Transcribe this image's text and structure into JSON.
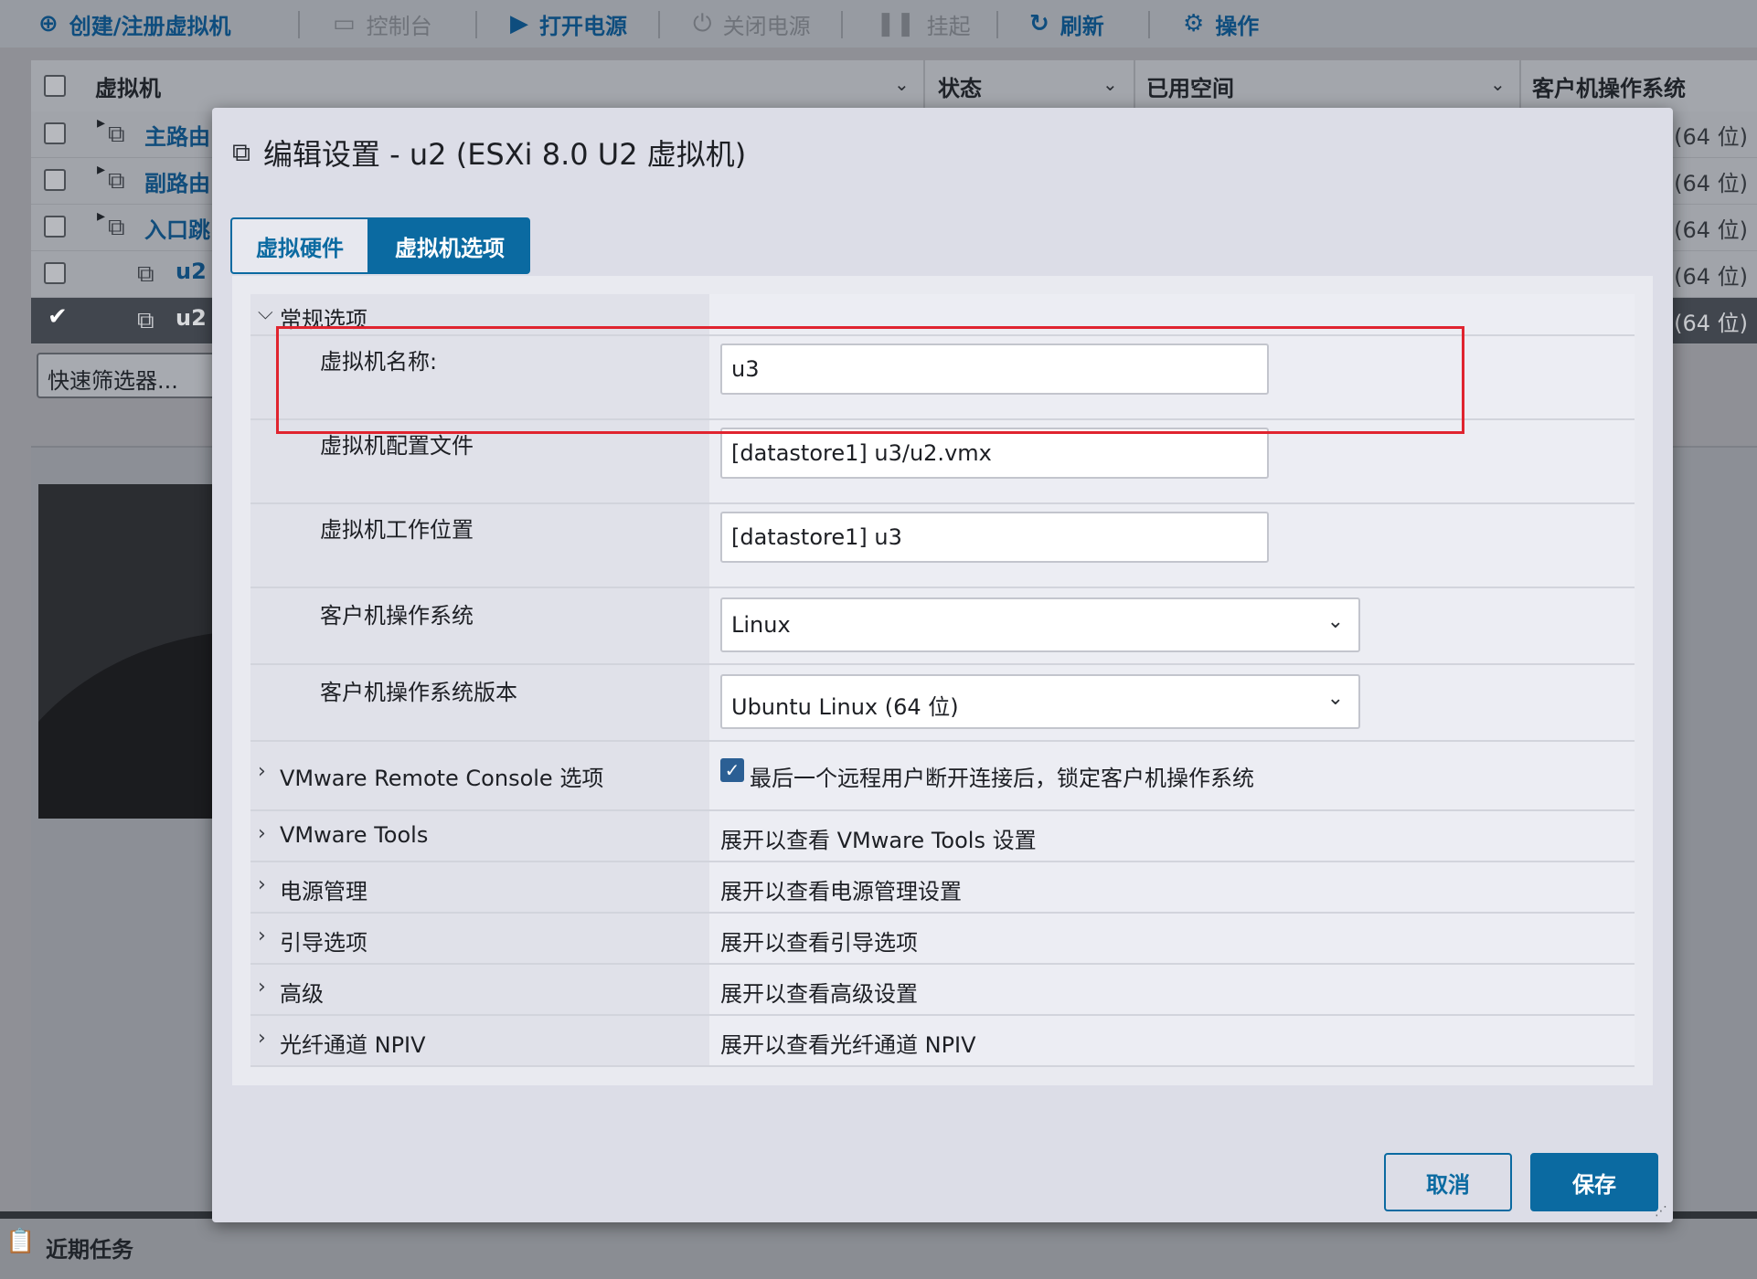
{
  "toolbar": {
    "create": "创建/注册虚拟机",
    "console": "控制台",
    "power_on": "打开电源",
    "power_off": "关闭电源",
    "suspend": "挂起",
    "refresh": "刷新",
    "actions": "操作"
  },
  "grid": {
    "headers": [
      "虚拟机",
      "状态",
      "已用空间",
      "客户机操作系统"
    ],
    "rows": [
      {
        "name": "主路由",
        "os": "(64 位)",
        "selected": false
      },
      {
        "name": "副路由",
        "os": "(64 位)",
        "selected": false
      },
      {
        "name": "入口跳",
        "os": "(64 位)",
        "selected": false
      },
      {
        "name": "u2",
        "os": "(64 位)",
        "selected": false
      },
      {
        "name": "u2",
        "os": "(64 位)",
        "selected": true
      }
    ],
    "filter_placeholder": "快速筛选器..."
  },
  "bottom": {
    "recent_tasks": "近期任务"
  },
  "dialog": {
    "title": "编辑设置 - u2 (ESXi 8.0 U2 虚拟机)",
    "tabs": [
      "虚拟硬件",
      "虚拟机选项"
    ],
    "active_tab": "虚拟机选项",
    "general_section": "常规选项",
    "fields": {
      "vm_name_label": "虚拟机名称:",
      "vm_name_value": "u3",
      "config_file_label": "虚拟机配置文件",
      "config_file_value": "[datastore1] u3/u2.vmx",
      "work_dir_label": "虚拟机工作位置",
      "work_dir_value": "[datastore1] u3",
      "guest_os_label": "客户机操作系统",
      "guest_os_value": "Linux",
      "guest_os_version_label": "客户机操作系统版本",
      "guest_os_version_value": "Ubuntu Linux (64 位)"
    },
    "sections": [
      {
        "label": "VMware Remote Console 选项",
        "value": "最后一个远程用户断开连接后，锁定客户机操作系统",
        "checked": true
      },
      {
        "label": "VMware Tools",
        "value": "展开以查看 VMware Tools 设置"
      },
      {
        "label": "电源管理",
        "value": "展开以查看电源管理设置"
      },
      {
        "label": "引导选项",
        "value": "展开以查看引导选项"
      },
      {
        "label": "高级",
        "value": "展开以查看高级设置"
      },
      {
        "label": "光纤通道 NPIV",
        "value": "展开以查看光纤通道 NPIV"
      }
    ],
    "buttons": {
      "cancel": "取消",
      "save": "保存"
    }
  },
  "colors": {
    "accent": "#0b6aa1",
    "highlight": "#e0242f"
  }
}
